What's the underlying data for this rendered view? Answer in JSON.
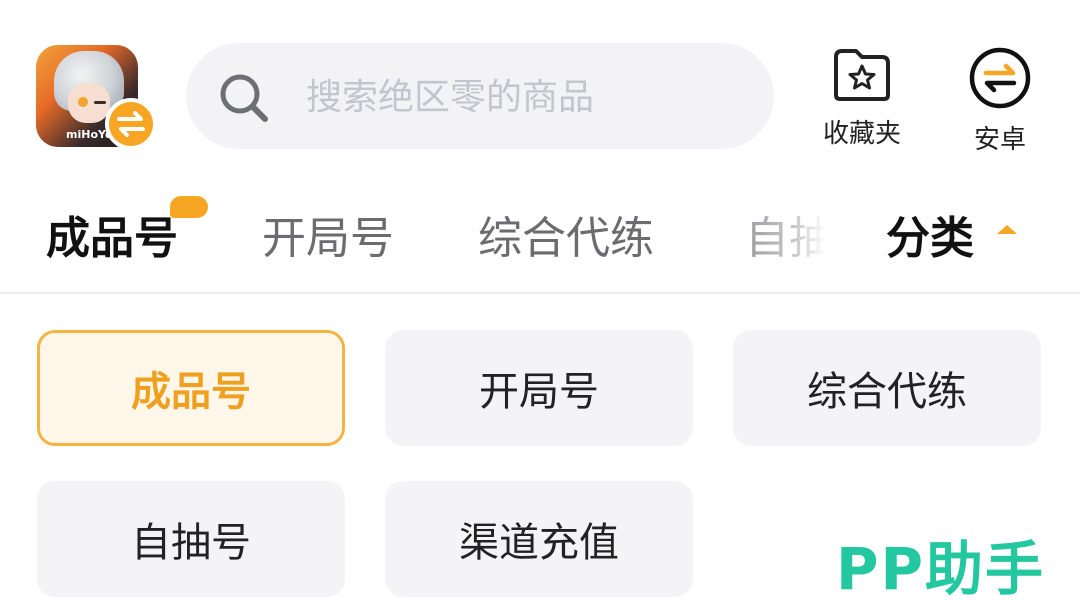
{
  "header": {
    "app_icon": {
      "name": "zenless-zone-zero-icon",
      "brand_text": "miHoYo",
      "badge_icon": "swap-icon",
      "badge_color": "#F6A623"
    },
    "search": {
      "placeholder": "搜索绝区零的商品",
      "icon": "search-icon"
    },
    "favorites": {
      "label": "收藏夹",
      "icon": "star-folder-icon"
    },
    "platform": {
      "label": "安卓",
      "icon": "swap-circle-icon"
    }
  },
  "tabs": {
    "items": [
      {
        "label": "成品号",
        "active": true
      },
      {
        "label": "开局号",
        "active": false
      },
      {
        "label": "综合代练",
        "active": false
      },
      {
        "label": "自抽",
        "active": false
      }
    ],
    "category": {
      "label": "分类",
      "icon": "caret-up-icon"
    }
  },
  "categories": {
    "items": [
      {
        "label": "成品号",
        "selected": true
      },
      {
        "label": "开局号",
        "selected": false
      },
      {
        "label": "综合代练",
        "selected": false
      },
      {
        "label": "自抽号",
        "selected": false
      },
      {
        "label": "渠道充值",
        "selected": false
      }
    ]
  },
  "watermark": {
    "text": "PP助手",
    "color": "#23C7A0"
  },
  "colors": {
    "accent": "#F6A623",
    "chip_bg": "#F4F4F6",
    "selected_text": "#F0A020"
  }
}
